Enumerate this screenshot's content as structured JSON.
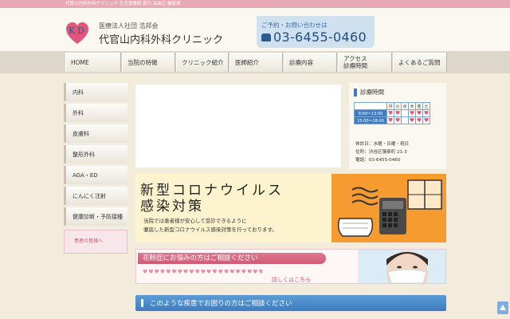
{
  "top_strip": "代官山内科外科クリニック 生活習慣病 渡力 高血圧 糖尿病",
  "header": {
    "org": "医療法人社団 浩邦会",
    "clinic_name": "代官山内科外科クリニック",
    "contact_label": "ご予約・お問い合わせは",
    "phone": "03-6455-0460"
  },
  "nav": [
    {
      "label": "HOME"
    },
    {
      "label": "当院の特徴"
    },
    {
      "label": "クリニック紹介"
    },
    {
      "label": "医師紹介"
    },
    {
      "label": "診療内容"
    },
    {
      "label": "アクセス\n診療時間"
    },
    {
      "label": "よくあるご質問"
    }
  ],
  "sidebar": [
    {
      "label": "内科"
    },
    {
      "label": "外科"
    },
    {
      "label": "皮膚科"
    },
    {
      "label": "整形外科"
    },
    {
      "label": "AGA・ED"
    },
    {
      "label": "にんにく注射"
    },
    {
      "label": "健康診断・予防接種"
    }
  ],
  "sidebar_banner": "患者の皆様へ",
  "hours": {
    "title": "診療時間",
    "days": [
      "月",
      "火",
      "水",
      "木",
      "金",
      "土"
    ],
    "rows": [
      {
        "time": "9:00〜13:00",
        "marks": [
          "♥",
          "♥",
          "",
          "♥",
          "♥",
          "♥"
        ]
      },
      {
        "time": "15:00〜18:00",
        "marks": [
          "♥",
          "♥",
          "",
          "♥",
          "♥",
          "♥"
        ]
      }
    ],
    "closed": "休診日：水曜・日曜・祝日",
    "address": "住所：渋谷区猿楽町 21-3",
    "tel": "電話：03-6455-0460"
  },
  "covid": {
    "title_line1": "新型コロナウイルス",
    "title_line2": "感染対策",
    "body_line1": "当院では患者様が安心して受診できるように",
    "body_line2": "徹底した新型コロナウイルス感染対策を行っております。"
  },
  "pollen": {
    "headline": "花粉症にお悩みの方はご相談ください",
    "link": "詳しくはこちら",
    "hearts": "♥♥♥♥♥♥♥♥♥♥♥♥♥♥♥♥♥♥♥♥♥♥♥♥♥♥♥♥♥♥♥♥♥♥♥♥♥♥♥♥♥♥"
  },
  "concern_bar": "このような疾患でお困りの方はご相談ください",
  "colors": {
    "accent_blue": "#3d7cc0",
    "accent_pink": "#e07891",
    "covid_orange": "#f59b2f"
  }
}
